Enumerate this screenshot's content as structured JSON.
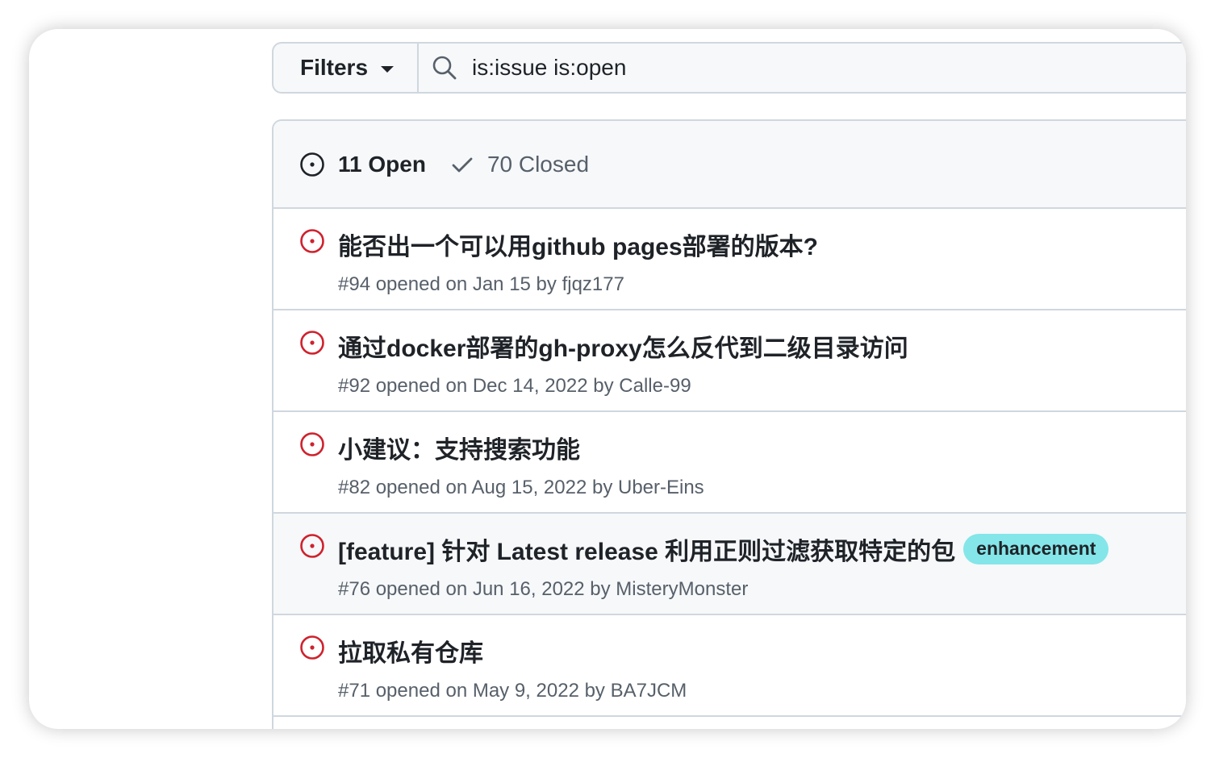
{
  "filters": {
    "button_label": "Filters",
    "search_value": "is:issue is:open"
  },
  "states": {
    "open_label": "11 Open",
    "closed_label": "70 Closed"
  },
  "issues": [
    {
      "title": "能否出一个可以用github pages部署的版本?",
      "meta": "#94 opened on Jan 15 by fjqz177"
    },
    {
      "title": "通过docker部署的gh-proxy怎么反代到二级目录访问",
      "meta": "#92 opened on Dec 14, 2022 by Calle-99"
    },
    {
      "title": "小建议：支持搜索功能",
      "meta": "#82 opened on Aug 15, 2022 by Uber-Eins"
    },
    {
      "title": "[feature] 针对 Latest release 利用正则过滤获取特定的包",
      "label": "enhancement",
      "meta": "#76 opened on Jun 16, 2022 by MisteryMonster"
    },
    {
      "title": "拉取私有仓库",
      "meta": "#71 opened on May 9, 2022 by BA7JCM"
    }
  ],
  "colors": {
    "open_icon": "#cf222e",
    "label_bg": "#84e6e8",
    "border": "#d0d7de",
    "header_bg": "#f6f8fa"
  }
}
